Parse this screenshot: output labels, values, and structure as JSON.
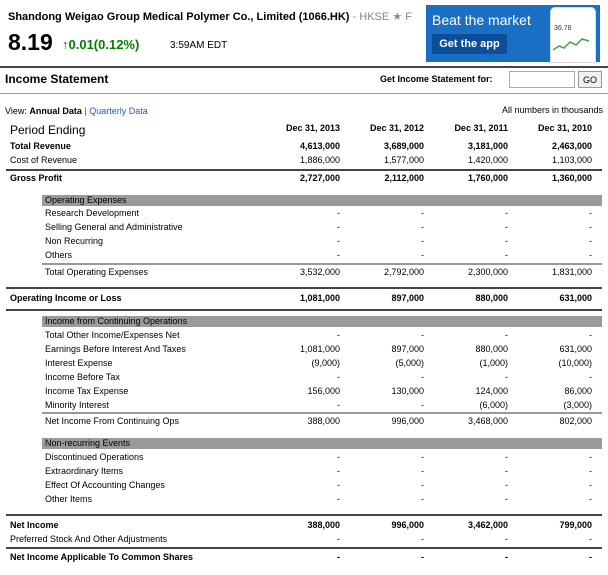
{
  "header": {
    "company": "Shandong Weigao Group Medical Polymer Co., Limited (1066.HK)",
    "exchange": "- HKSE",
    "star": "★ F",
    "price": "8.19",
    "change": "↑0.01(0.12%)",
    "time": "3:59AM EDT"
  },
  "ad": {
    "title": "Beat the market",
    "button": "Get the app",
    "phone_value": "36.78"
  },
  "section": {
    "title": "Income Statement",
    "get_label": "Get Income Statement for:",
    "input_value": "",
    "go": "GO"
  },
  "view": {
    "prefix": "View:",
    "annual": "Annual Data",
    "sep": "|",
    "quarterly": "Quarterly Data",
    "units": "All numbers in thousands"
  },
  "table": {
    "period_label": "Period Ending",
    "periods": [
      "Dec 31, 2013",
      "Dec 31, 2012",
      "Dec 31, 2011",
      "Dec 31, 2010"
    ],
    "rows": {
      "total_revenue": {
        "label": "Total Revenue",
        "values": [
          "4,613,000",
          "3,689,000",
          "3,181,000",
          "2,463,000"
        ]
      },
      "cost_of_revenue": {
        "label": "Cost of Revenue",
        "values": [
          "1,886,000",
          "1,577,000",
          "1,420,000",
          "1,103,000"
        ]
      },
      "gross_profit": {
        "label": "Gross Profit",
        "values": [
          "2,727,000",
          "2,112,000",
          "1,760,000",
          "1,360,000"
        ]
      },
      "opex_header": {
        "label": "Operating Expenses"
      },
      "research": {
        "label": "Research Development",
        "values": [
          "-",
          "-",
          "-",
          "-"
        ]
      },
      "sga": {
        "label": "Selling General and Administrative",
        "values": [
          "-",
          "-",
          "-",
          "-"
        ]
      },
      "non_recurring": {
        "label": "Non Recurring",
        "values": [
          "-",
          "-",
          "-",
          "-"
        ]
      },
      "others": {
        "label": "Others",
        "values": [
          "-",
          "-",
          "-",
          "-"
        ]
      },
      "total_opex": {
        "label": "Total Operating Expenses",
        "values": [
          "3,532,000",
          "2,792,000",
          "2,300,000",
          "1,831,000"
        ]
      },
      "operating_income": {
        "label": "Operating Income or Loss",
        "values": [
          "1,081,000",
          "897,000",
          "880,000",
          "631,000"
        ]
      },
      "cont_header": {
        "label": "Income from Continuing Operations"
      },
      "total_other": {
        "label": "Total Other Income/Expenses Net",
        "values": [
          "-",
          "-",
          "-",
          "-"
        ]
      },
      "ebit": {
        "label": "Earnings Before Interest And Taxes",
        "values": [
          "1,081,000",
          "897,000",
          "880,000",
          "631,000"
        ]
      },
      "interest_expense": {
        "label": "Interest Expense",
        "values": [
          "(9,000)",
          "(5,000)",
          "(1,000)",
          "(10,000)"
        ]
      },
      "income_before_tax": {
        "label": "Income Before Tax",
        "values": [
          "-",
          "-",
          "-",
          "-"
        ]
      },
      "income_tax": {
        "label": "Income Tax Expense",
        "values": [
          "156,000",
          "130,000",
          "124,000",
          "86,000"
        ]
      },
      "minority": {
        "label": "Minority Interest",
        "values": [
          "-",
          "-",
          "(6,000)",
          "(3,000)"
        ]
      },
      "net_income_cont": {
        "label": "Net Income From Continuing Ops",
        "values": [
          "388,000",
          "996,000",
          "3,468,000",
          "802,000"
        ]
      },
      "nonrec_header": {
        "label": "Non-recurring Events"
      },
      "discontinued": {
        "label": "Discontinued Operations",
        "values": [
          "-",
          "-",
          "-",
          "-"
        ]
      },
      "extraordinary": {
        "label": "Extraordinary Items",
        "values": [
          "-",
          "-",
          "-",
          "-"
        ]
      },
      "accounting": {
        "label": "Effect Of Accounting Changes",
        "values": [
          "-",
          "-",
          "-",
          "-"
        ]
      },
      "other_items": {
        "label": "Other Items",
        "values": [
          "-",
          "-",
          "-",
          "-"
        ]
      },
      "net_income": {
        "label": "Net Income",
        "values": [
          "388,000",
          "996,000",
          "3,462,000",
          "799,000"
        ]
      },
      "preferred": {
        "label": "Preferred Stock And Other Adjustments",
        "values": [
          "-",
          "-",
          "-",
          "-"
        ]
      },
      "net_income_common": {
        "label": "Net Income Applicable To Common Shares",
        "values": [
          "-",
          "-",
          "-",
          "-"
        ]
      }
    }
  }
}
